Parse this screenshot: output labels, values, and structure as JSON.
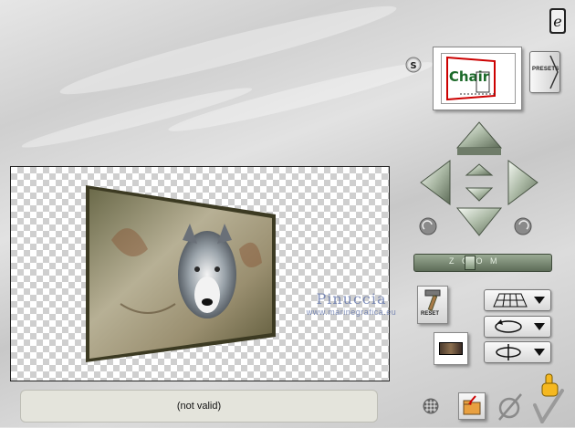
{
  "status": {
    "text": "(not valid)"
  },
  "presets": {
    "label": "PRESETS",
    "thumb_text": "Chair"
  },
  "reset": {
    "label": "RESET"
  },
  "zoom": {
    "label": "Z O O M"
  },
  "watermark": {
    "line1": "Pinuccia",
    "line2": "www.marinegrafica.eu"
  },
  "icons": {
    "settings": "s-button-icon",
    "help": "corel-logo-icon",
    "grid": "grid-icon",
    "folder": "folder-icon",
    "cancel": "cancel-icon",
    "ok": "ok-check-icon"
  }
}
